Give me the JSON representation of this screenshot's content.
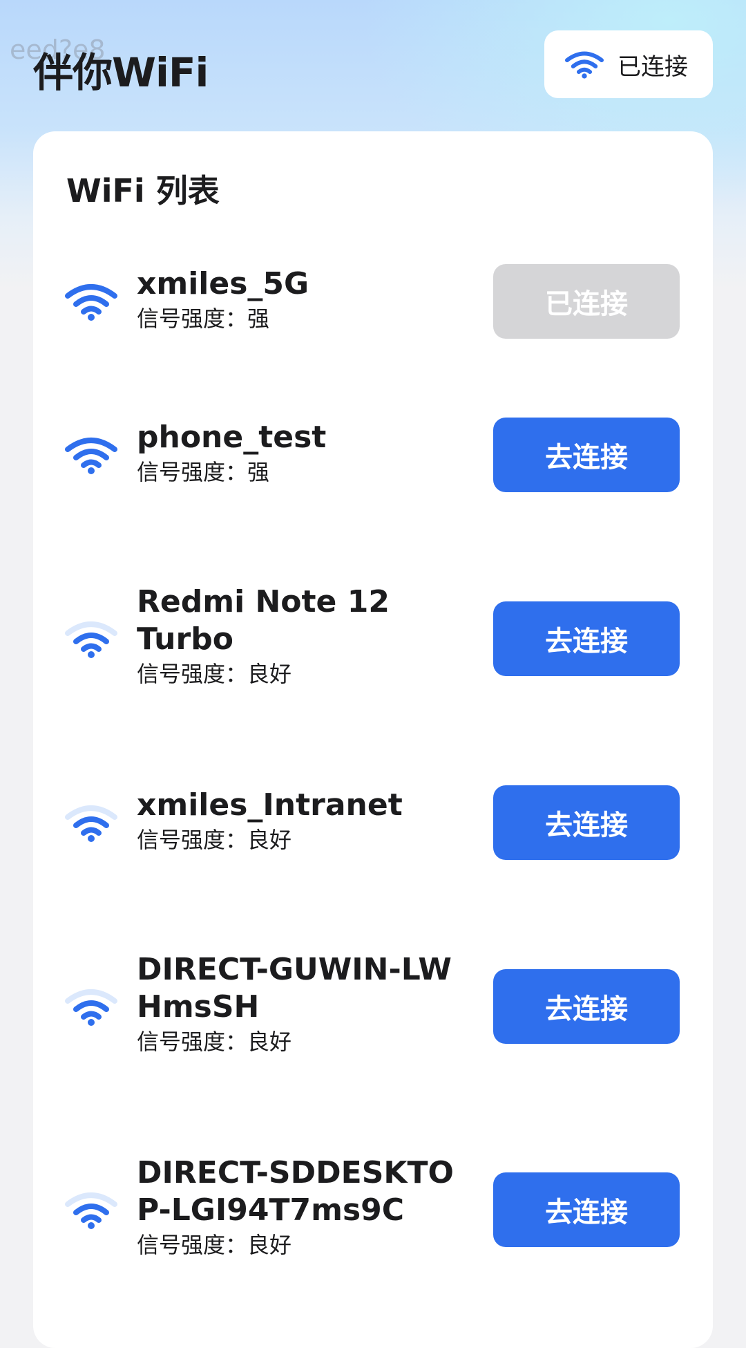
{
  "watermark": "eed?e8",
  "app_title": "伴你WiFi",
  "status_pill": {
    "label": "已连接",
    "icon": "wifi-icon"
  },
  "list_title": "WiFi 列表",
  "colors": {
    "accent": "#2f6fed",
    "wifi_icon": "#2f6fed",
    "wifi_icon_faded": "#dbe8fc",
    "disabled_button": "#d5d5d7"
  },
  "networks": [
    {
      "ssid": "xmiles_5G",
      "signal": "信号强度：强",
      "strength": "strong",
      "button": "已连接",
      "connected": true
    },
    {
      "ssid": "phone_test",
      "signal": "信号强度：强",
      "strength": "strong",
      "button": "去连接",
      "connected": false
    },
    {
      "ssid": "Redmi Note 12 Turbo",
      "signal": "信号强度：良好",
      "strength": "good",
      "button": "去连接",
      "connected": false
    },
    {
      "ssid": "xmiles_Intranet",
      "signal": "信号强度：良好",
      "strength": "good",
      "button": "去连接",
      "connected": false
    },
    {
      "ssid": "DIRECT-GUWIN-LWHmsSH",
      "signal": "信号强度：良好",
      "strength": "good",
      "button": "去连接",
      "connected": false
    },
    {
      "ssid": "DIRECT-SDDESKTOP-LGI94T7ms9C",
      "signal": "信号强度：良好",
      "strength": "good",
      "button": "去连接",
      "connected": false
    }
  ]
}
